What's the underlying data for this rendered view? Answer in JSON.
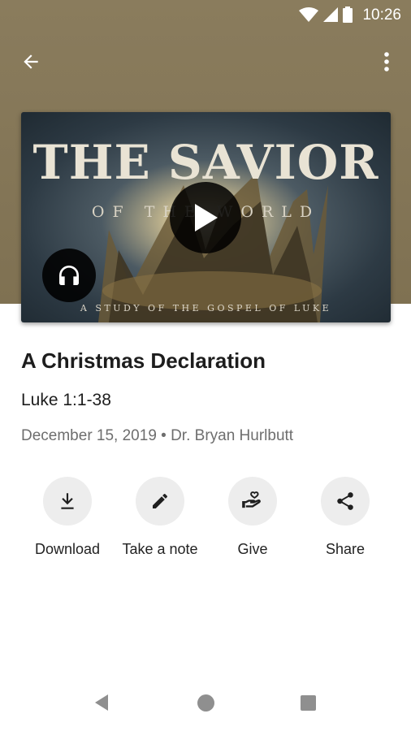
{
  "status_bar": {
    "time": "10:26",
    "icons": [
      "wifi-icon",
      "signal-icon",
      "battery-icon"
    ]
  },
  "toolbar": {
    "back_icon": "arrow-back-icon",
    "more_icon": "more-vert-icon"
  },
  "artwork": {
    "title": "THE SAVIOR",
    "subtitle": "OF THE WORLD",
    "caption": "A STUDY OF THE GOSPEL OF LUKE",
    "play_icon": "play-icon",
    "audio_icon": "headphones-icon"
  },
  "sermon": {
    "title": "A Christmas Declaration",
    "scripture": "Luke 1:1-38",
    "meta": "December 15, 2019 • Dr. Bryan Hurlbutt"
  },
  "actions": [
    {
      "label": "Download",
      "icon": "download-icon"
    },
    {
      "label": "Take a note",
      "icon": "pencil-icon"
    },
    {
      "label": "Give",
      "icon": "give-heart-hand-icon"
    },
    {
      "label": "Share",
      "icon": "share-icon"
    }
  ],
  "colors": {
    "header": "#857757",
    "action_circle": "#ededed",
    "meta_text": "#6e6e6e"
  }
}
